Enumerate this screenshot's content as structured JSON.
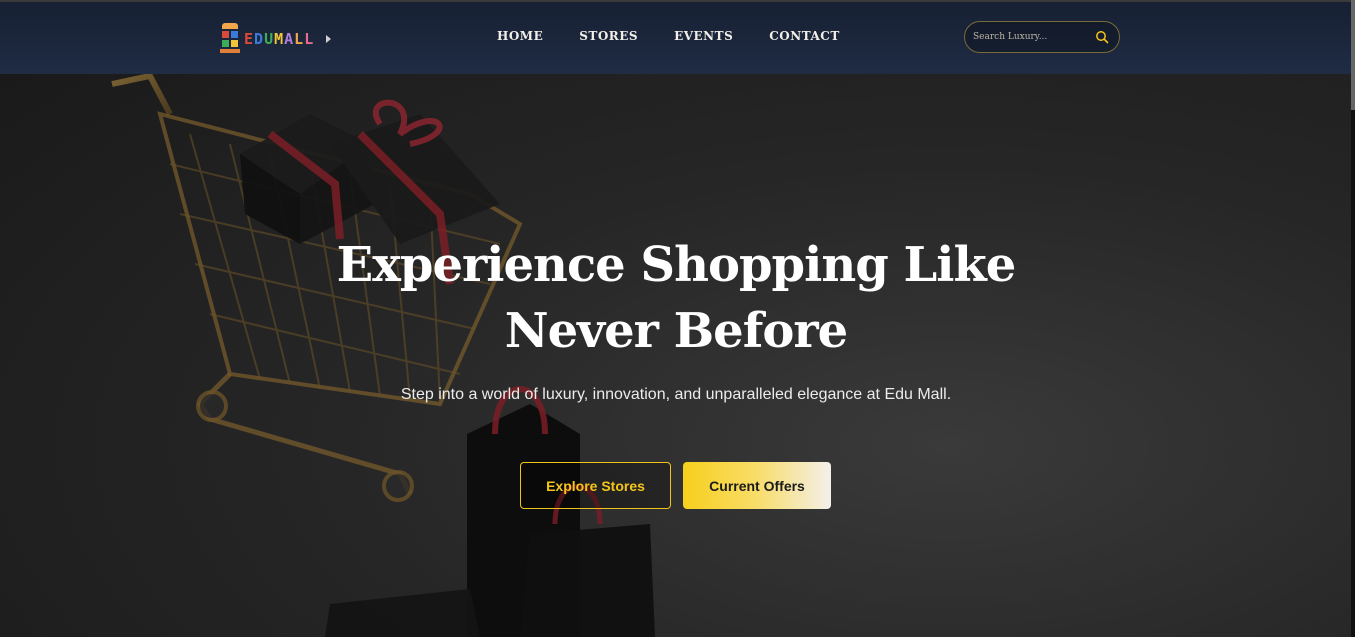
{
  "brand": {
    "logo_letters": [
      "E",
      "D",
      "U",
      "M",
      "A",
      "L",
      "L"
    ],
    "colors": [
      "#d94a3a",
      "#3b7ad9",
      "#3cae5a",
      "#f2c53a",
      "#b07ed9",
      "#f2a54a",
      "#e86a8a"
    ]
  },
  "nav": {
    "items": [
      {
        "label": "HOME"
      },
      {
        "label": "STORES"
      },
      {
        "label": "EVENTS"
      },
      {
        "label": "CONTACT"
      }
    ]
  },
  "search": {
    "placeholder": "Search Luxury...",
    "value": "",
    "icon": "search-icon"
  },
  "hero": {
    "title_line1": "Experience Shopping Like",
    "title_line2": "Never Before",
    "subtitle": "Step into a world of luxury, innovation, and unparalleled elegance at Edu Mall.",
    "primary_button": "Explore Stores",
    "secondary_button": "Current Offers"
  },
  "theme": {
    "accent": "#f5c518",
    "header_bg": "#1f2c44",
    "hero_bg": "#262626"
  }
}
